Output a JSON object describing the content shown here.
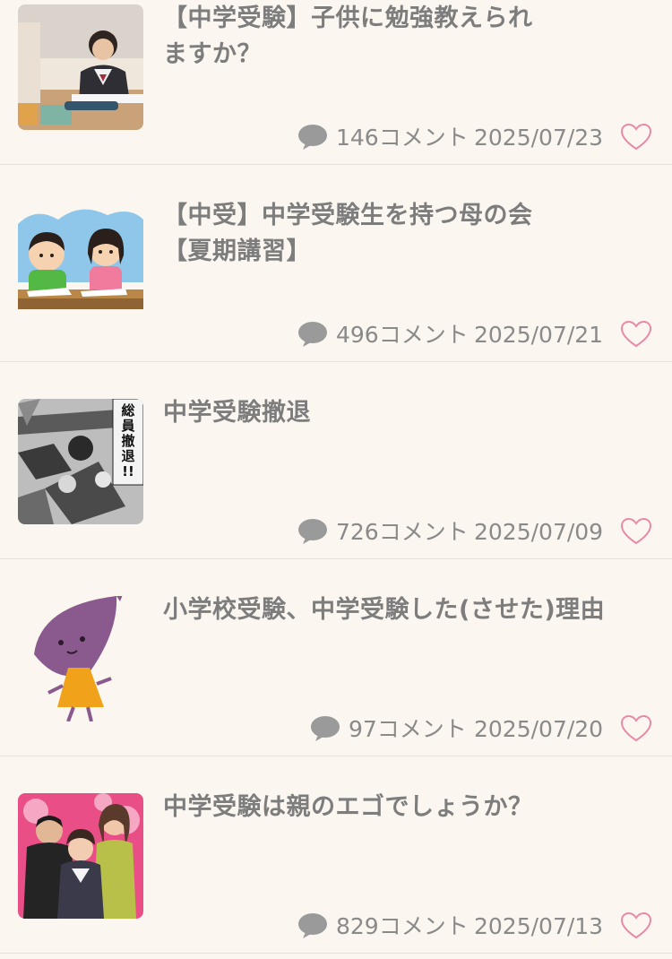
{
  "posts": [
    {
      "title_lines": [
        "【中学受験】子供に勉強教えられ",
        "ますか？"
      ],
      "comments": "146コメント",
      "date": "2025/07/23",
      "thumbnail": "student-desk-photo"
    },
    {
      "title_lines": [
        "【中受】中学受験生を持つ母の会",
        "【夏期講習】"
      ],
      "comments": "496コメント",
      "date": "2025/07/21",
      "thumbnail": "kids-studying-illustration"
    },
    {
      "title_lines": [
        "中学受験撤退",
        ""
      ],
      "comments": "726コメント",
      "date": "2025/07/09",
      "thumbnail": "manga-retreat-panel",
      "thumbnail_text": "総員撤退!!"
    },
    {
      "title_lines": [
        "小学校受験、中学受験した(させた)理由",
        ""
      ],
      "comments": "97コメント",
      "date": "2025/07/20",
      "thumbnail": "sweet-potato-character"
    },
    {
      "title_lines": [
        "中学受験は親のエゴでしょうか？",
        ""
      ],
      "comments": "829コメント",
      "date": "2025/07/13",
      "thumbnail": "drama-poster-family"
    }
  ],
  "icons": {
    "comment": "comment-bubble-icon",
    "favorite": "heart-outline-icon"
  },
  "colors": {
    "background": "#fbf6f0",
    "title": "#7d7d7d",
    "meta": "#8a8a8a",
    "heart": "#e88aa6",
    "divider": "#e7e0d8"
  }
}
